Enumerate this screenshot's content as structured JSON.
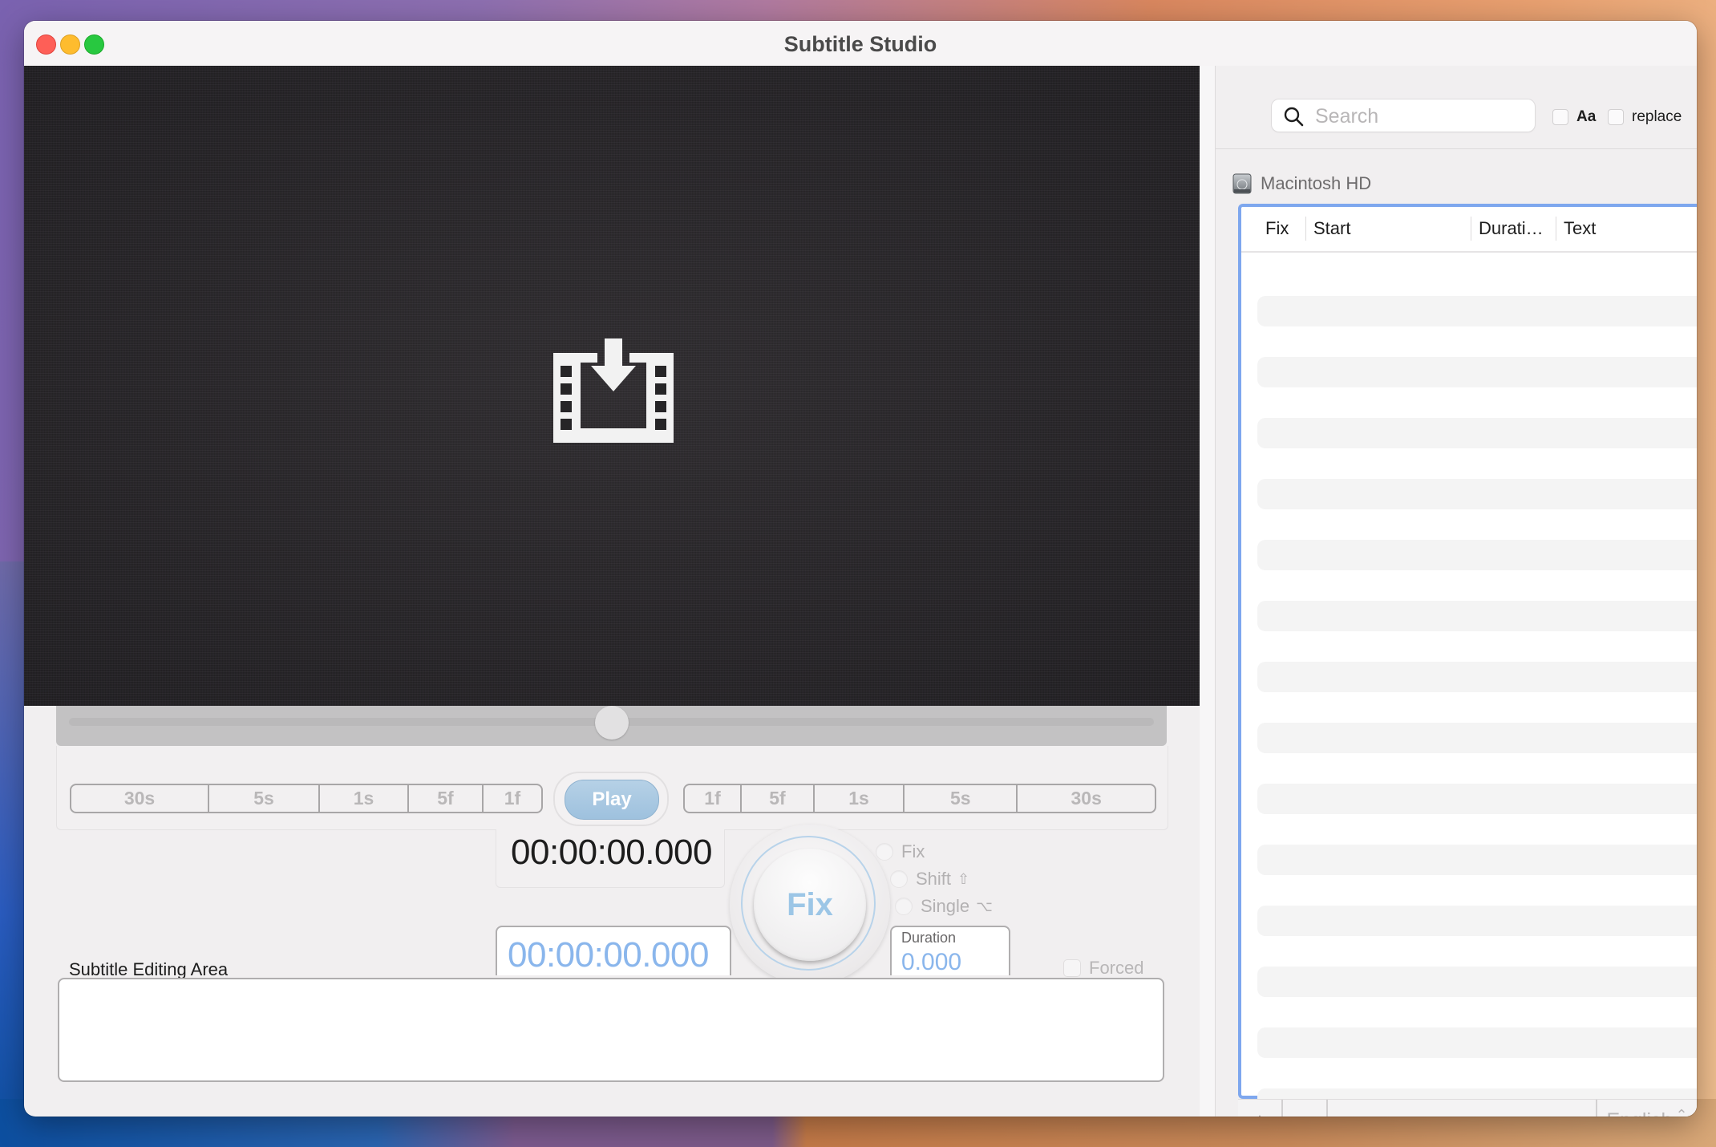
{
  "window": {
    "title": "Subtitle Studio",
    "controls": [
      "close",
      "minimize",
      "maximize"
    ]
  },
  "video": {
    "placeholder_icon": "film-download-icon",
    "playhead_fraction": 0.5
  },
  "transport": {
    "back_steps": [
      "30s",
      "5s",
      "1s",
      "5f",
      "1f"
    ],
    "play_label": "Play",
    "forward_steps": [
      "1f",
      "5f",
      "1s",
      "5s",
      "30s"
    ]
  },
  "timing": {
    "current_time": "00:00:00.000",
    "start_time": "00:00:00.000",
    "duration_label": "Duration",
    "duration_value": "0.000"
  },
  "fix": {
    "button_label": "Fix",
    "modes": [
      {
        "label": "Fix",
        "shortcut": ""
      },
      {
        "label": "Shift",
        "shortcut": "⇧"
      },
      {
        "label": "Single",
        "shortcut": "⌥"
      }
    ]
  },
  "editor": {
    "label": "Subtitle Editing Area",
    "text": "",
    "forced_label": "Forced",
    "forced_checked": false
  },
  "sidebar": {
    "search": {
      "placeholder": "Search",
      "value": ""
    },
    "match_case_label": "Aa",
    "match_case_checked": false,
    "replace_label": "replace",
    "replace_checked": false,
    "volume_name": "Macintosh HD",
    "table": {
      "columns": [
        "Fix",
        "Start",
        "Durati…",
        "Text"
      ],
      "rows": []
    },
    "add_label": "+",
    "remove_label": "-",
    "language": "English"
  },
  "colors": {
    "accent_blue": "#7ea7ee",
    "time_blue": "#8ab6ec",
    "play_blue": "#9ec1de"
  }
}
